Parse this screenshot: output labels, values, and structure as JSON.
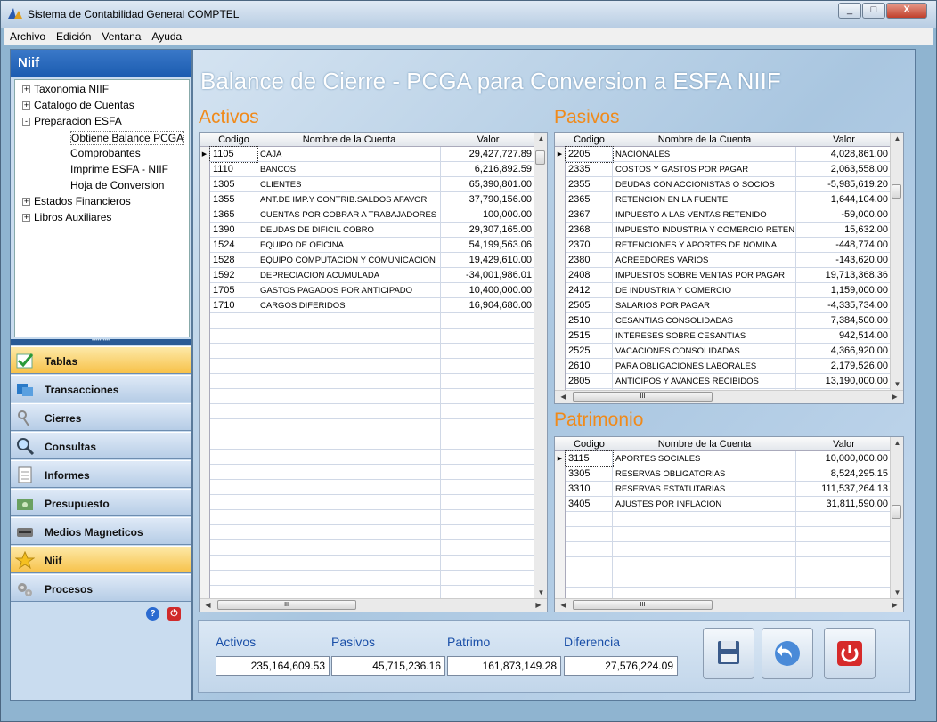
{
  "window": {
    "title": "Sistema de Contabilidad General COMPTEL",
    "min": "_",
    "max": "□",
    "close": "X"
  },
  "menu": [
    "Archivo",
    "Edición",
    "Ventana",
    "Ayuda"
  ],
  "left": {
    "header": "Niif",
    "tree": [
      {
        "label": "Taxonomia NIIF",
        "level": 0,
        "pm": "+"
      },
      {
        "label": "Catalogo de Cuentas",
        "level": 0,
        "pm": "+"
      },
      {
        "label": "Preparacion ESFA",
        "level": 0,
        "pm": "-"
      },
      {
        "label": "Obtiene Balance PCGA",
        "level": 1,
        "pm": ""
      },
      {
        "label": "Comprobantes",
        "level": 1,
        "pm": ""
      },
      {
        "label": "Imprime ESFA - NIIF",
        "level": 1,
        "pm": ""
      },
      {
        "label": "Hoja de Conversion",
        "level": 1,
        "pm": ""
      },
      {
        "label": "Estados Financieros",
        "level": 0,
        "pm": "+"
      },
      {
        "label": "Libros Auxiliares",
        "level": 0,
        "pm": "+"
      }
    ],
    "nav": [
      {
        "label": "Tablas",
        "icon": "table-check-icon",
        "active": true
      },
      {
        "label": "Transacciones",
        "icon": "transactions-icon",
        "active": false
      },
      {
        "label": "Cierres",
        "icon": "keys-icon",
        "active": false
      },
      {
        "label": "Consultas",
        "icon": "magnifier-icon",
        "active": false
      },
      {
        "label": "Informes",
        "icon": "report-icon",
        "active": false
      },
      {
        "label": "Presupuesto",
        "icon": "budget-icon",
        "active": false
      },
      {
        "label": "Medios Magneticos",
        "icon": "disk-drive-icon",
        "active": false
      },
      {
        "label": "Niif",
        "icon": "star-icon",
        "active": true
      },
      {
        "label": "Procesos",
        "icon": "gears-icon",
        "active": false
      }
    ],
    "help": "?"
  },
  "main": {
    "title": "Balance de Cierre - PCGA para Conversion a ESFA NIIF",
    "columns": {
      "codigo": "Codigo",
      "nombre": "Nombre de la Cuenta",
      "valor": "Valor"
    },
    "activos": {
      "title": "Activos",
      "rows": [
        [
          "1105",
          "CAJA",
          "29,427,727.89"
        ],
        [
          "1110",
          "BANCOS",
          "6,216,892.59"
        ],
        [
          "1305",
          "CLIENTES",
          "65,390,801.00"
        ],
        [
          "1355",
          "ANT.DE IMP.Y CONTRIB.SALDOS AFAVOR",
          "37,790,156.00"
        ],
        [
          "1365",
          "CUENTAS POR COBRAR A TRABAJADORES",
          "100,000.00"
        ],
        [
          "1390",
          "DEUDAS DE DIFICIL COBRO",
          "29,307,165.00"
        ],
        [
          "1524",
          "EQUIPO DE OFICINA",
          "54,199,563.06"
        ],
        [
          "1528",
          "EQUIPO COMPUTACION Y COMUNICACION",
          "19,429,610.00"
        ],
        [
          "1592",
          "DEPRECIACION ACUMULADA",
          "-34,001,986.01"
        ],
        [
          "1705",
          "GASTOS PAGADOS POR ANTICIPADO",
          "10,400,000.00"
        ],
        [
          "1710",
          "CARGOS DIFERIDOS",
          "16,904,680.00"
        ]
      ]
    },
    "pasivos": {
      "title": "Pasivos",
      "rows": [
        [
          "2205",
          "NACIONALES",
          "4,028,861.00"
        ],
        [
          "2335",
          "COSTOS Y GASTOS POR PAGAR",
          "2,063,558.00"
        ],
        [
          "2355",
          "DEUDAS CON ACCIONISTAS O SOCIOS",
          "-5,985,619.20"
        ],
        [
          "2365",
          "RETENCION EN LA FUENTE",
          "1,644,104.00"
        ],
        [
          "2367",
          "IMPUESTO A LAS VENTAS RETENIDO",
          "-59,000.00"
        ],
        [
          "2368",
          "IMPUESTO INDUSTRIA Y COMERCIO RETENI",
          "15,632.00"
        ],
        [
          "2370",
          "RETENCIONES Y APORTES DE NOMINA",
          "-448,774.00"
        ],
        [
          "2380",
          "ACREEDORES VARIOS",
          "-143,620.00"
        ],
        [
          "2408",
          "IMPUESTOS SOBRE VENTAS POR PAGAR",
          "19,713,368.36"
        ],
        [
          "2412",
          "DE INDUSTRIA Y COMERCIO",
          "1,159,000.00"
        ],
        [
          "2505",
          "SALARIOS POR PAGAR",
          "-4,335,734.00"
        ],
        [
          "2510",
          "CESANTIAS CONSOLIDADAS",
          "7,384,500.00"
        ],
        [
          "2515",
          "INTERESES SOBRE CESANTIAS",
          "942,514.00"
        ],
        [
          "2525",
          "VACACIONES CONSOLIDADAS",
          "4,366,920.00"
        ],
        [
          "2610",
          "PARA OBLIGACIONES LABORALES",
          "2,179,526.00"
        ],
        [
          "2805",
          "ANTICIPOS Y AVANCES RECIBIDOS",
          "13,190,000.00"
        ]
      ]
    },
    "patrimonio": {
      "title": "Patrimonio",
      "rows": [
        [
          "3115",
          "APORTES SOCIALES",
          "10,000,000.00"
        ],
        [
          "3305",
          "RESERVAS OBLIGATORIAS",
          "8,524,295.15"
        ],
        [
          "3310",
          "RESERVAS ESTATUTARIAS",
          "111,537,264.13"
        ],
        [
          "3405",
          "AJUSTES POR INFLACION",
          "31,811,590.00"
        ]
      ]
    },
    "scroll_grip": "III",
    "totals": {
      "activos_label": "Activos",
      "activos": "235,164,609.53",
      "pasivos_label": "Pasivos",
      "pasivos": "45,715,236.16",
      "patrimo_label": "Patrimo",
      "patrimo": "161,873,149.28",
      "diferencia_label": "Diferencia",
      "diferencia": "27,576,224.09"
    }
  }
}
